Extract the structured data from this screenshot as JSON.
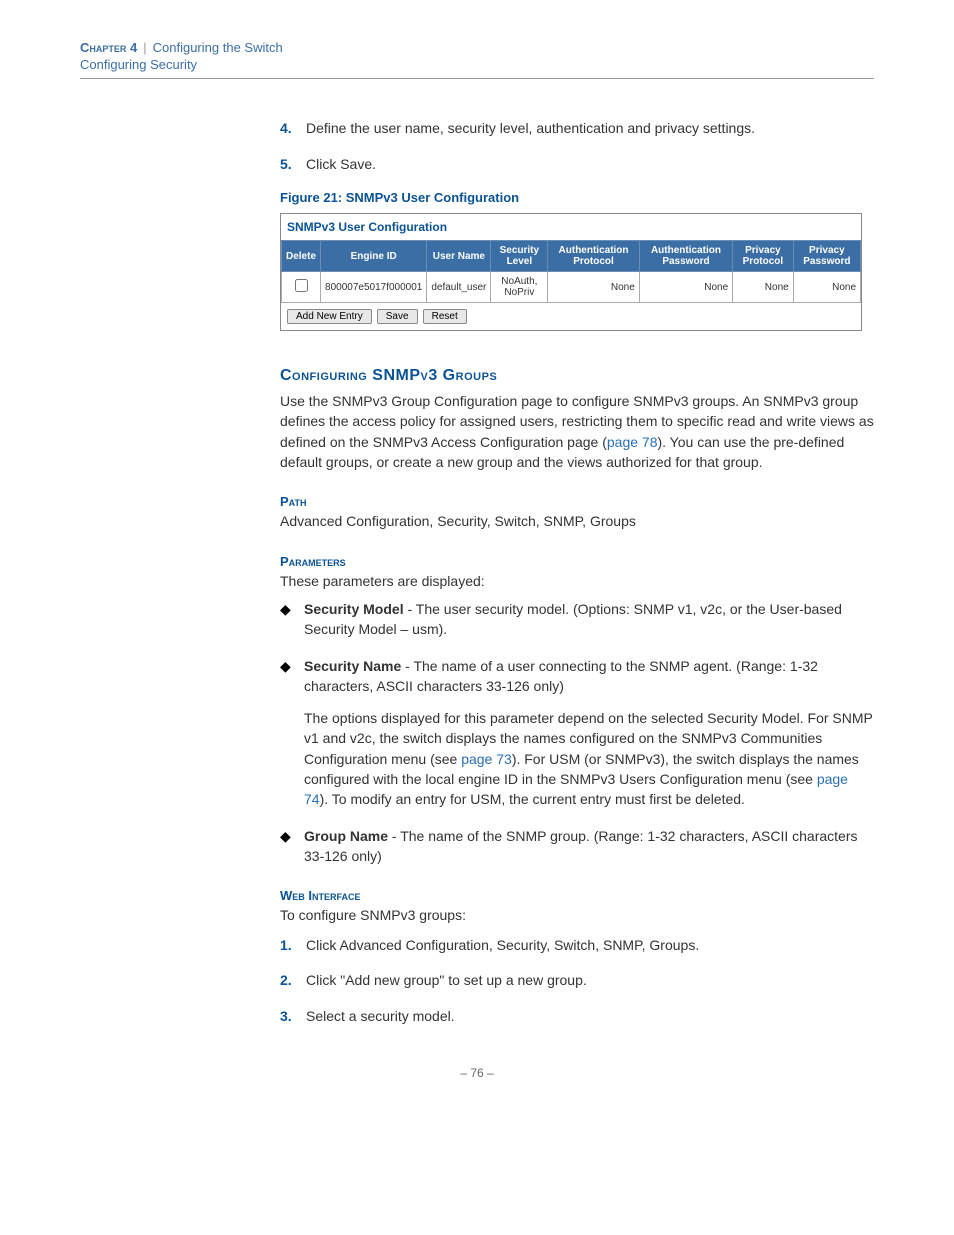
{
  "header": {
    "chapter": "Chapter 4",
    "sep": "|",
    "title": "Configuring the Switch",
    "subtitle": "Configuring Security"
  },
  "topSteps": [
    {
      "num": "4.",
      "text": "Define the user name, security level, authentication and privacy settings."
    },
    {
      "num": "5.",
      "text": "Click Save."
    }
  ],
  "figure": {
    "caption": "Figure 21:  SNMPv3 User Configuration",
    "title": "SNMPv3 User Configuration",
    "headers": [
      "Delete",
      "Engine ID",
      "User Name",
      "Security Level",
      "Authentication Protocol",
      "Authentication Password",
      "Privacy Protocol",
      "Privacy Password"
    ],
    "row": {
      "engine_id": "800007e5017f000001",
      "user_name": "default_user",
      "security_level": "NoAuth, NoPriv",
      "auth_protocol": "None",
      "auth_password": "None",
      "priv_protocol": "None",
      "priv_password": "None"
    },
    "buttons": {
      "add": "Add New Entry",
      "save": "Save",
      "reset": "Reset"
    }
  },
  "section": {
    "heading": "Configuring SNMPv3 Groups",
    "intro_a": "Use the SNMPv3 Group Configuration page to configure SNMPv3 groups. An SNMPv3 group defines the access policy for assigned users, restricting them to specific read and write views as defined on the SNMPv3 Access Configuration page (",
    "intro_link": "page 78",
    "intro_b": "). You can use the pre-defined default groups, or create a new group and the views authorized for that group."
  },
  "path": {
    "label": "Path",
    "text": "Advanced Configuration, Security, Switch, SNMP, Groups"
  },
  "params": {
    "label": "Parameters",
    "intro": "These parameters are displayed:",
    "items": [
      {
        "name": "Security Model",
        "desc": " - The user security model. (Options: SNMP v1, v2c, or the User-based Security Model – usm)."
      },
      {
        "name": "Security Name",
        "desc": " - The name of a user connecting to the SNMP agent. (Range: 1-32 characters, ASCII characters 33-126 only)",
        "extra_a": "The options displayed for this parameter depend on the selected Security Model. For SNMP v1 and v2c, the switch displays the names configured on the SNMPv3 Communities Configuration menu (see ",
        "extra_link1": "page 73",
        "extra_b": "). For USM (or SNMPv3), the switch displays the names configured with the local engine ID in the SNMPv3 Users Configuration menu (see ",
        "extra_link2": "page 74",
        "extra_c": "). To modify an entry for USM, the current entry must first be deleted."
      },
      {
        "name": "Group Name",
        "desc": " - The name of the SNMP group. (Range: 1-32 characters, ASCII characters 33-126 only)"
      }
    ]
  },
  "web": {
    "label": "Web Interface",
    "intro": "To configure SNMPv3 groups:",
    "steps": [
      {
        "num": "1.",
        "text": "Click Advanced Configuration, Security, Switch, SNMP, Groups."
      },
      {
        "num": "2.",
        "text": "Click \"Add new group\" to set up a new group."
      },
      {
        "num": "3.",
        "text": "Select a security model."
      }
    ]
  },
  "pageNumber": "– 76 –"
}
